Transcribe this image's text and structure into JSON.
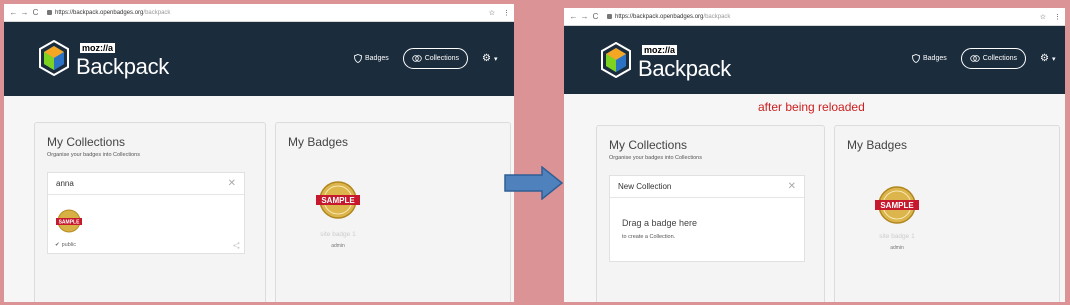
{
  "browser": {
    "nav_back": "←",
    "nav_forward": "→",
    "nav_reload": "C",
    "url_host": "https://backpack.openbadges.org",
    "url_path": "/backpack",
    "star": "☆",
    "menu": "⋮"
  },
  "header": {
    "logo_moz": "moz://a",
    "logo_brand": "Backpack",
    "nav_badges": "Badges",
    "nav_collections": "Collections",
    "gear_icon": "gear-icon",
    "caret": "▾"
  },
  "before": {
    "collections_title": "My Collections",
    "collections_sub": "Organise your badges into Collections",
    "collection_name": "anna",
    "close": "✕",
    "public_check": "✔",
    "public_label": "public",
    "share_icon": "share-icon",
    "badges_title": "My Badges",
    "badge_seal": "SAMPLE",
    "badge_caption": "site badge 1",
    "badge_owner": "admin"
  },
  "after": {
    "reload_note": "after being reloaded",
    "collections_title": "My Collections",
    "collections_sub": "Organise your badges into Collections",
    "new_collection": "New Collection",
    "close": "✕",
    "drag_title": "Drag a badge here",
    "drag_sub": "to create a Collection.",
    "badges_title": "My Badges",
    "badge_seal": "SAMPLE",
    "badge_caption": "site badge 1",
    "badge_owner": "admin"
  },
  "colors": {
    "background": "#dc9395",
    "header": "#1b2c3d",
    "accent_red": "#cc1f1f",
    "arrow": "#4f81bd"
  }
}
